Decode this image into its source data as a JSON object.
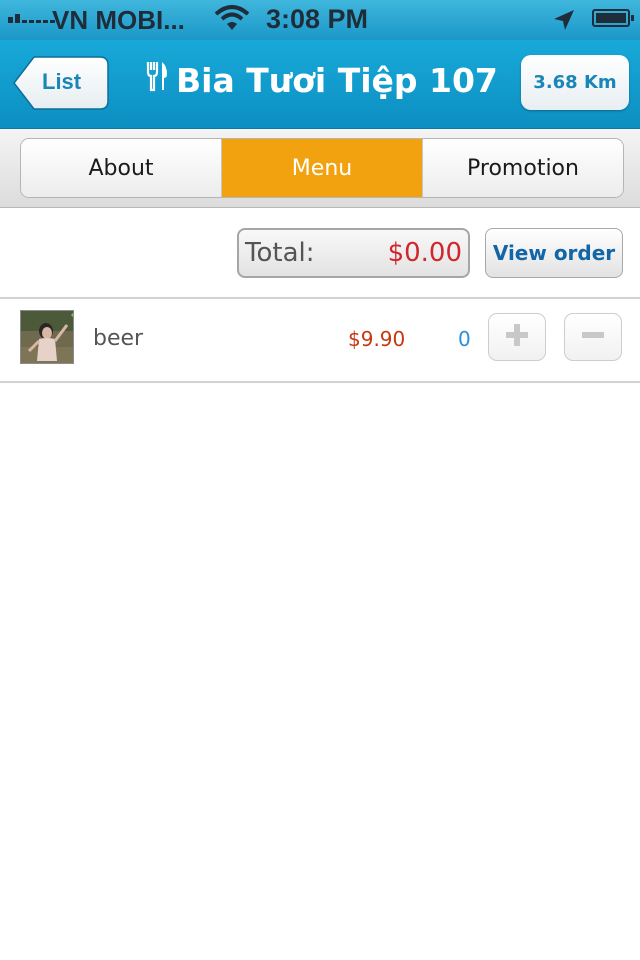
{
  "status_bar": {
    "carrier": "VN MOBI...",
    "time": "3:08 PM"
  },
  "nav": {
    "back_label": "List",
    "title": "Bia Tươi Tiệp 107",
    "distance": "3.68 Km"
  },
  "tabs": [
    {
      "label": "About",
      "active": false
    },
    {
      "label": "Menu",
      "active": true
    },
    {
      "label": "Promotion",
      "active": false
    }
  ],
  "order": {
    "total_label": "Total:",
    "total_value": "$0.00",
    "view_order_label": "View order"
  },
  "items": [
    {
      "name": "beer",
      "price": "$9.90",
      "quantity": "0"
    }
  ],
  "colors": {
    "navbar": "#0c8fc2",
    "active_tab": "#f2a20f",
    "total_value": "#d0262c",
    "price": "#c8370f",
    "quantity": "#2a8fd6"
  }
}
